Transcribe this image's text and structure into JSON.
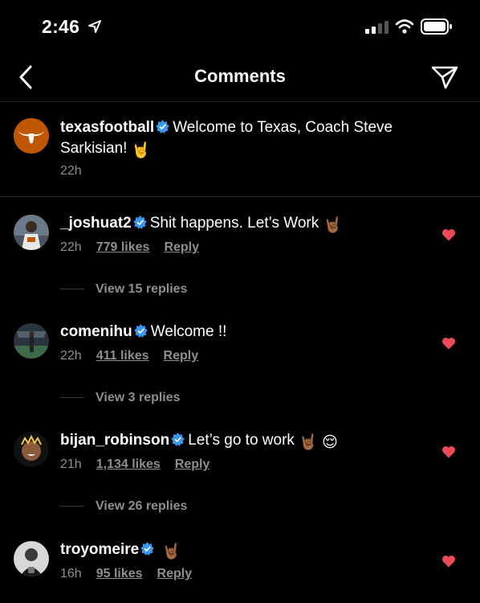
{
  "status_bar": {
    "time": "2:46"
  },
  "nav": {
    "title": "Comments"
  },
  "caption": {
    "username": "texasfootball",
    "text": "Welcome to Texas, Coach Steve Sarkisian!",
    "emoji": "🤘",
    "time": "22h"
  },
  "comments": [
    {
      "username": "_joshuat2",
      "text": "Shit happens. Let’s Work",
      "emoji": "🤘🏾",
      "time": "22h",
      "likes": "779 likes",
      "reply": "Reply",
      "view_replies": "View 15 replies"
    },
    {
      "username": "comenihu",
      "text": "Welcome !!",
      "emoji": "",
      "time": "22h",
      "likes": "411 likes",
      "reply": "Reply",
      "view_replies": "View 3 replies"
    },
    {
      "username": "bijan_robinson",
      "text": "Let’s go to work",
      "emoji": "🤘🏾 😌",
      "time": "21h",
      "likes": "1,134 likes",
      "reply": "Reply",
      "view_replies": "View 26 replies"
    },
    {
      "username": "troyomeire",
      "text": "",
      "emoji": "🤘🏾",
      "time": "16h",
      "likes": "95 likes",
      "reply": "Reply"
    }
  ],
  "colors": {
    "background": "#000000",
    "secondary_text": "#8e8e8e",
    "verified": "#3897f0",
    "heart": "#ed4956",
    "texas_orange": "#bf5700"
  },
  "icons": [
    "location-arrow-icon",
    "signal-icon",
    "wifi-icon",
    "battery-icon",
    "back-chevron-icon",
    "send-icon",
    "verified-badge-icon",
    "heart-icon"
  ]
}
